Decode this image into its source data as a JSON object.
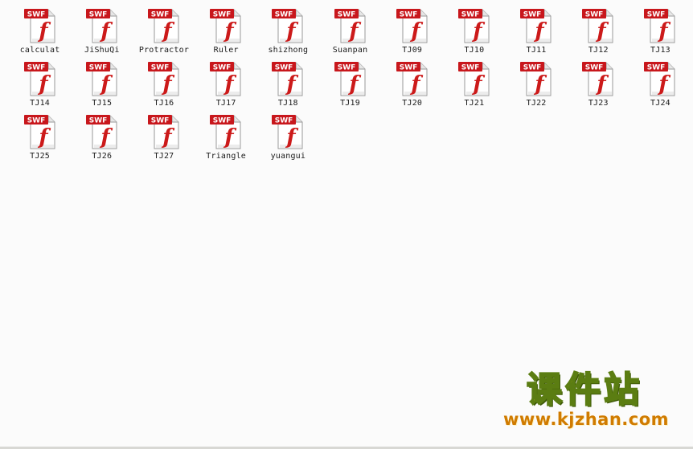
{
  "icon": {
    "name": "swf-file-icon",
    "badge": "SWF",
    "badge_color": "#c8171c",
    "glyph_color": "#cc1a1a"
  },
  "files": [
    {
      "label": "calculat"
    },
    {
      "label": "JiShuQi"
    },
    {
      "label": "Protractor"
    },
    {
      "label": "Ruler"
    },
    {
      "label": "shizhong"
    },
    {
      "label": "Suanpan"
    },
    {
      "label": "TJ09"
    },
    {
      "label": "TJ10"
    },
    {
      "label": "TJ11"
    },
    {
      "label": "TJ12"
    },
    {
      "label": "TJ13"
    },
    {
      "label": "TJ14"
    },
    {
      "label": "TJ15"
    },
    {
      "label": "TJ16"
    },
    {
      "label": "TJ17"
    },
    {
      "label": "TJ18"
    },
    {
      "label": "TJ19"
    },
    {
      "label": "TJ20"
    },
    {
      "label": "TJ21"
    },
    {
      "label": "TJ22"
    },
    {
      "label": "TJ23"
    },
    {
      "label": "TJ24"
    },
    {
      "label": "TJ25"
    },
    {
      "label": "TJ26"
    },
    {
      "label": "TJ27"
    },
    {
      "label": "Triangle"
    },
    {
      "label": "yuangui"
    }
  ],
  "watermark": {
    "title": "课件站",
    "url": "www.kjzhan.com"
  }
}
